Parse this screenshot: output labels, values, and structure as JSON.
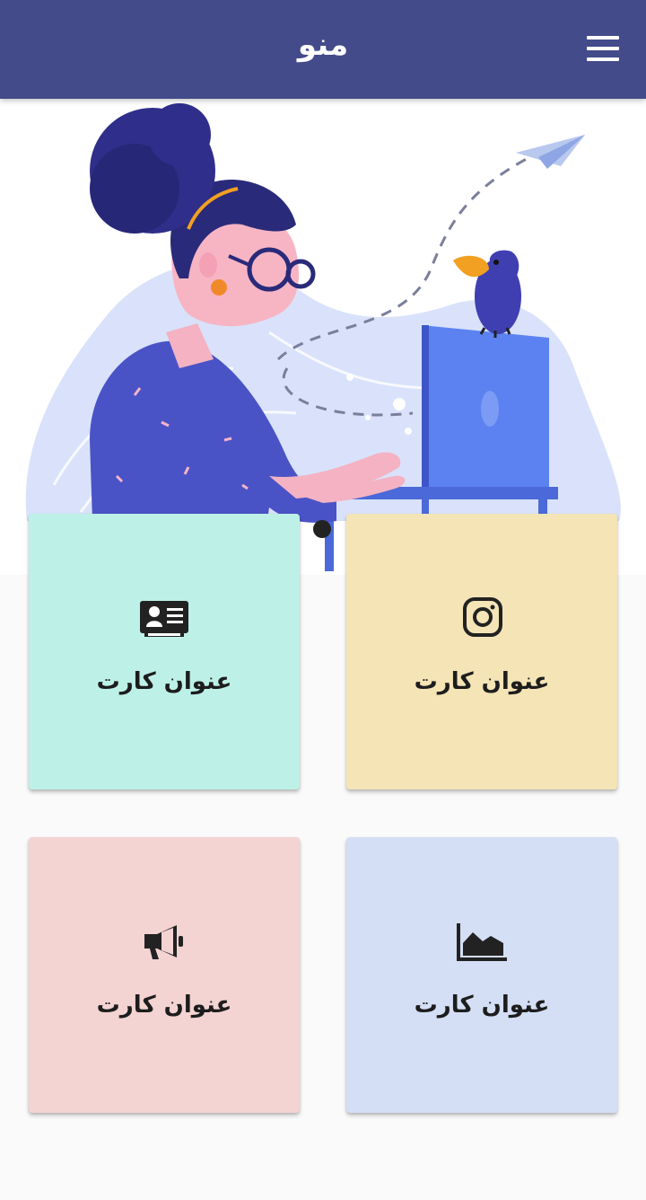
{
  "appbar": {
    "title": "منو",
    "menu_icon": "hamburger-menu-icon",
    "background": "#434b8b"
  },
  "carousel": {
    "slide_count": 1,
    "active_index": 0
  },
  "cards": [
    {
      "label": "عنوان کارت",
      "icon": "id-card-icon",
      "color": "#bdf1e7"
    },
    {
      "label": "عنوان کارت",
      "icon": "instagram-icon",
      "color": "#f4e4b6"
    },
    {
      "label": "عنوان کارت",
      "icon": "megaphone-icon",
      "color": "#f4d3d3"
    },
    {
      "label": "عنوان کارت",
      "icon": "area-chart-icon",
      "color": "#d4dff5"
    }
  ]
}
